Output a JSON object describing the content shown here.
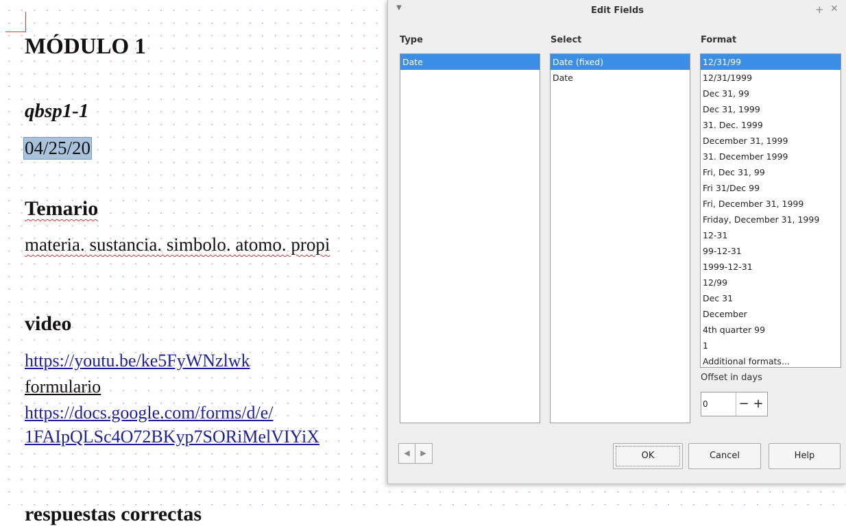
{
  "document": {
    "heading_module": "MÓDULO 1",
    "code": "qbsp1-1",
    "date_field": "04/25/20",
    "heading_temario": "Temario",
    "temario_text": "materia. sustancia. simbolo. atomo. propi",
    "heading_video": "video",
    "video_link": "https://youtu.be/ke5FyWNzlwk",
    "form_label": "formulario",
    "form_link_1": "https://docs.google.com/forms/d/e/",
    "form_link_2": "1FAIpQLSc4O72BKyp7SORiMelVIYiX",
    "heading_respuestas": "respuestas correctas"
  },
  "dialog": {
    "title": "Edit Fields",
    "type_header": "Type",
    "select_header": "Select",
    "format_header": "Format",
    "type_items": [
      "Date"
    ],
    "select_items": [
      "Date (fixed)",
      "Date"
    ],
    "format_items": [
      "12/31/99",
      "12/31/1999",
      "Dec 31, 99",
      "Dec 31, 1999",
      "31. Dec. 1999",
      "December 31, 1999",
      "31. December 1999",
      "Fri, Dec 31, 99",
      "Fri 31/Dec 99",
      "Fri, December 31, 1999",
      "Friday, December 31, 1999",
      "12-31",
      "99-12-31",
      "1999-12-31",
      "12/99",
      "Dec 31",
      "December",
      "4th quarter 99",
      "1",
      "Additional formats..."
    ],
    "offset_label": "Offset in days",
    "offset_value": "0",
    "ok_label": "OK",
    "cancel_label": "Cancel",
    "help_label": "Help"
  },
  "colors": {
    "selection": "#3a8ee6",
    "link": "#1d1f9b",
    "grid_dots": "#e79a9a"
  }
}
